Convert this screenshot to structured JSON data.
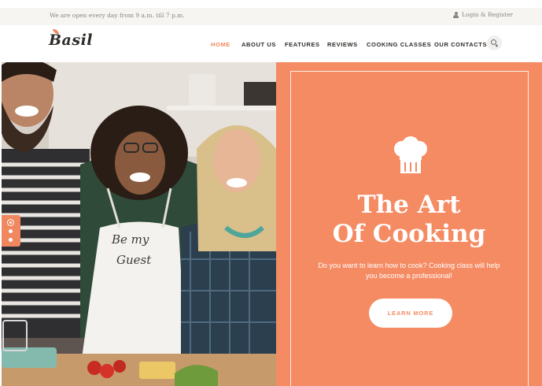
{
  "topbar": {
    "hours_text": "We are open every day from 9 a.m. till 7 p.m.",
    "login_label": "Login & Register",
    "user_icon": "user-icon"
  },
  "header": {
    "logo_text": "Basil",
    "nav": [
      {
        "label": "HOME",
        "active": true
      },
      {
        "label": "ABOUT US",
        "active": false
      },
      {
        "label": "FEATURES",
        "active": false
      },
      {
        "label": "REVIEWS",
        "active": false
      },
      {
        "label": "COOKING CLASSES",
        "active": false
      },
      {
        "label": "OUR CONTACTS",
        "active": false
      }
    ],
    "search_icon": "search-icon"
  },
  "hero": {
    "photo_text": "Be my Guest",
    "chef_icon": "chef-hat-icon",
    "title_line1": "The Art",
    "title_line2": "Of Cooking",
    "subtitle_line1": "Do you want to learn how to cook? Cooking class will help",
    "subtitle_line2": "you become a professional!",
    "button_label": "LEARN MORE",
    "slides": {
      "count": 3,
      "active": 1
    }
  },
  "colors": {
    "accent": "#f58b63",
    "nav_active": "#f0875f",
    "text_dark": "#2e2b28",
    "topbar_bg": "#f7f5f2"
  }
}
